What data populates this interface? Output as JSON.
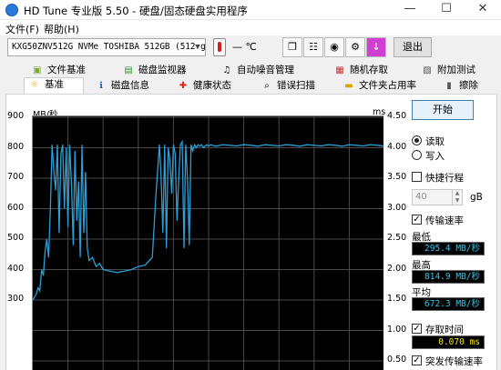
{
  "window": {
    "title": "HD Tune 专业版 5.50 - 硬盘/固态硬盘实用程序"
  },
  "menu": {
    "file": "文件(F)",
    "help": "帮助(H)"
  },
  "toolbar": {
    "drive": "KXG50ZNV512G NVMe TOSHIBA 512GB (512 gB)",
    "temperature": "— ℃",
    "exit_label": "退出"
  },
  "tabs_row1": [
    "文件基准",
    "磁盘监视器",
    "自动噪音管理",
    "随机存取",
    "附加测试"
  ],
  "tabs_row2": [
    "基准",
    "磁盘信息",
    "健康状态",
    "错误扫描",
    "文件夹占用率",
    "擦除"
  ],
  "chart_data": {
    "type": "line",
    "title": "",
    "ylabel_left": "MB/秒",
    "ylabel_right": "ms",
    "y_left_ticks": [
      "900",
      "800",
      "700",
      "600",
      "500",
      "400",
      "300"
    ],
    "y_right_ticks": [
      "4.50",
      "4.00",
      "3.50",
      "3.00",
      "2.50",
      "2.00",
      "1.50",
      "1.00",
      "0.50"
    ],
    "ylim_left": [
      250,
      900
    ],
    "ylim_right": [
      0.25,
      4.5
    ],
    "grid": true,
    "series": [
      {
        "color": "#2a9fd6",
        "x": [
          0,
          1,
          1.5,
          2,
          2.5,
          3,
          3.5,
          4,
          4.5,
          5,
          5.5,
          6,
          6.5,
          7,
          7.5,
          8,
          8.5,
          9,
          9.5,
          10,
          10.5,
          11,
          11.5,
          12,
          12.5,
          13,
          13.5,
          14,
          14.5,
          15,
          15.5,
          16,
          17,
          18,
          19,
          20,
          22,
          24,
          26,
          28,
          30,
          32,
          34,
          35,
          36,
          36.5,
          37,
          37.5,
          38,
          38.5,
          39,
          39.5,
          40,
          40.5,
          41,
          41.5,
          42,
          42.5,
          43,
          43.5,
          44,
          44.5,
          45,
          45.5,
          46,
          46.5,
          47,
          47.5,
          48,
          48.5,
          49,
          49.5,
          50,
          50.5,
          51,
          52,
          54,
          56,
          58,
          60,
          62,
          64,
          66,
          68,
          70,
          72,
          74,
          76,
          78,
          80,
          82,
          84,
          86,
          88,
          90,
          92,
          94,
          96,
          98,
          100
        ],
        "values": [
          300,
          320,
          340,
          330,
          400,
          380,
          460,
          500,
          440,
          600,
          810,
          720,
          660,
          810,
          520,
          780,
          810,
          600,
          800,
          540,
          810,
          680,
          480,
          790,
          560,
          690,
          440,
          810,
          520,
          720,
          470,
          430,
          440,
          410,
          420,
          400,
          395,
          390,
          395,
          400,
          410,
          415,
          440,
          640,
          810,
          700,
          520,
          810,
          470,
          800,
          760,
          650,
          810,
          780,
          560,
          700,
          810,
          820,
          470,
          810,
          700,
          480,
          810,
          790,
          810,
          800,
          810,
          805,
          810,
          800,
          805,
          810,
          805,
          810,
          808,
          805,
          810,
          808,
          806,
          810,
          808,
          805,
          810,
          808,
          806,
          810,
          808,
          805,
          810,
          808,
          806,
          810,
          808,
          805,
          810,
          808,
          806,
          810,
          808,
          805
        ]
      }
    ]
  },
  "sidebar": {
    "start_label": "开始",
    "read_label": "读取",
    "write_label": "写入",
    "short_stroke_label": "快捷行程",
    "short_stroke_value": "40",
    "short_stroke_unit": "gB",
    "transfer_rate_label": "传输速率",
    "min_label": "最低",
    "min_value": "295.4 MB/秒",
    "max_label": "最高",
    "max_value": "814.9 MB/秒",
    "avg_label": "平均",
    "avg_value": "672.3 MB/秒",
    "access_time_label": "存取时间",
    "access_time_value": "0.070 ms",
    "burst_rate_label": "突发传输速率"
  }
}
